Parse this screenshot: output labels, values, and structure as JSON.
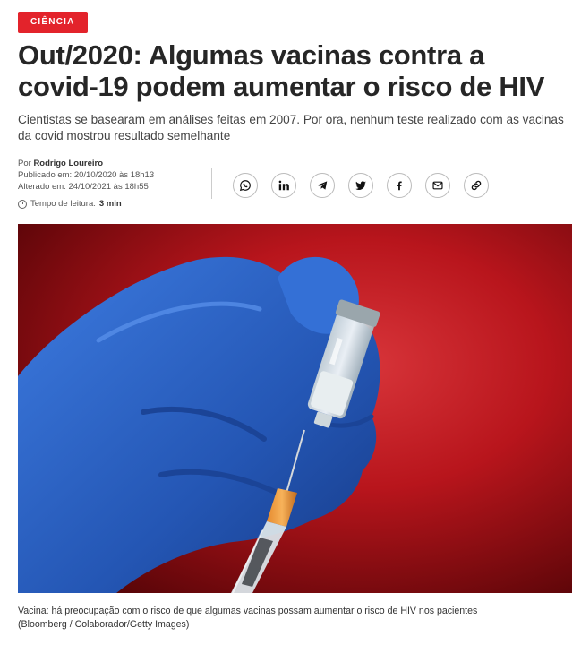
{
  "article": {
    "category": "CIÊNCIA",
    "title": "Out/2020: Algumas vacinas contra a covid-19 podem aumentar o risco de HIV",
    "subtitle": "Cientistas se basearam em análises feitas em 2007. Por ora, nenhum teste realizado com as vacinas da covid mostrou resultado semelhante",
    "byline_prefix": "Por",
    "author": "Rodrigo Loureiro",
    "published": "Publicado em: 20/10/2020 às 18h13",
    "updated": "Alterado em: 24/10/2021 às 18h55",
    "reading_time_label": "Tempo de leitura:",
    "reading_time_value": "3 min",
    "caption": "Vacina: há preocupação com o risco de que algumas vacinas possam aumentar o risco de HIV nos pacientes (Bloomberg / Colaborador/Getty Images)"
  },
  "share_icons": [
    "whatsapp-icon",
    "linkedin-icon",
    "telegram-icon",
    "twitter-icon",
    "facebook-icon",
    "email-icon",
    "link-icon"
  ],
  "colors": {
    "accent": "#e3232b",
    "glove": "#2f64c8",
    "background_red": "#b8151c"
  }
}
